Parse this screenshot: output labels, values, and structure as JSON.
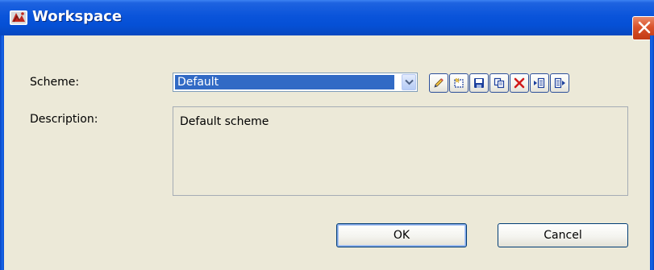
{
  "window": {
    "title": "Workspace",
    "icon": "workspace-app-icon",
    "close_icon": "close-icon"
  },
  "form": {
    "scheme_label": "Scheme:",
    "scheme_value": "Default",
    "description_label": "Description:",
    "description_value": "Default scheme"
  },
  "toolbar": [
    {
      "icon": "pencil-edit-icon",
      "tooltip": ""
    },
    {
      "icon": "new-scheme-icon",
      "tooltip": ""
    },
    {
      "icon": "save-icon",
      "tooltip": ""
    },
    {
      "icon": "copy-icon",
      "tooltip": ""
    },
    {
      "icon": "delete-icon",
      "tooltip": ""
    },
    {
      "icon": "import-icon",
      "tooltip": ""
    },
    {
      "icon": "export-icon",
      "tooltip": ""
    }
  ],
  "buttons": {
    "ok_label": "OK",
    "cancel_label": "Cancel"
  },
  "colors": {
    "title_bar": "#0a54da",
    "selection": "#316ac5",
    "close_button": "#d9522b",
    "delete_icon": "#d11a1a",
    "icon_blue": "#1b3f9c",
    "dialog_background": "#ece9d8"
  }
}
